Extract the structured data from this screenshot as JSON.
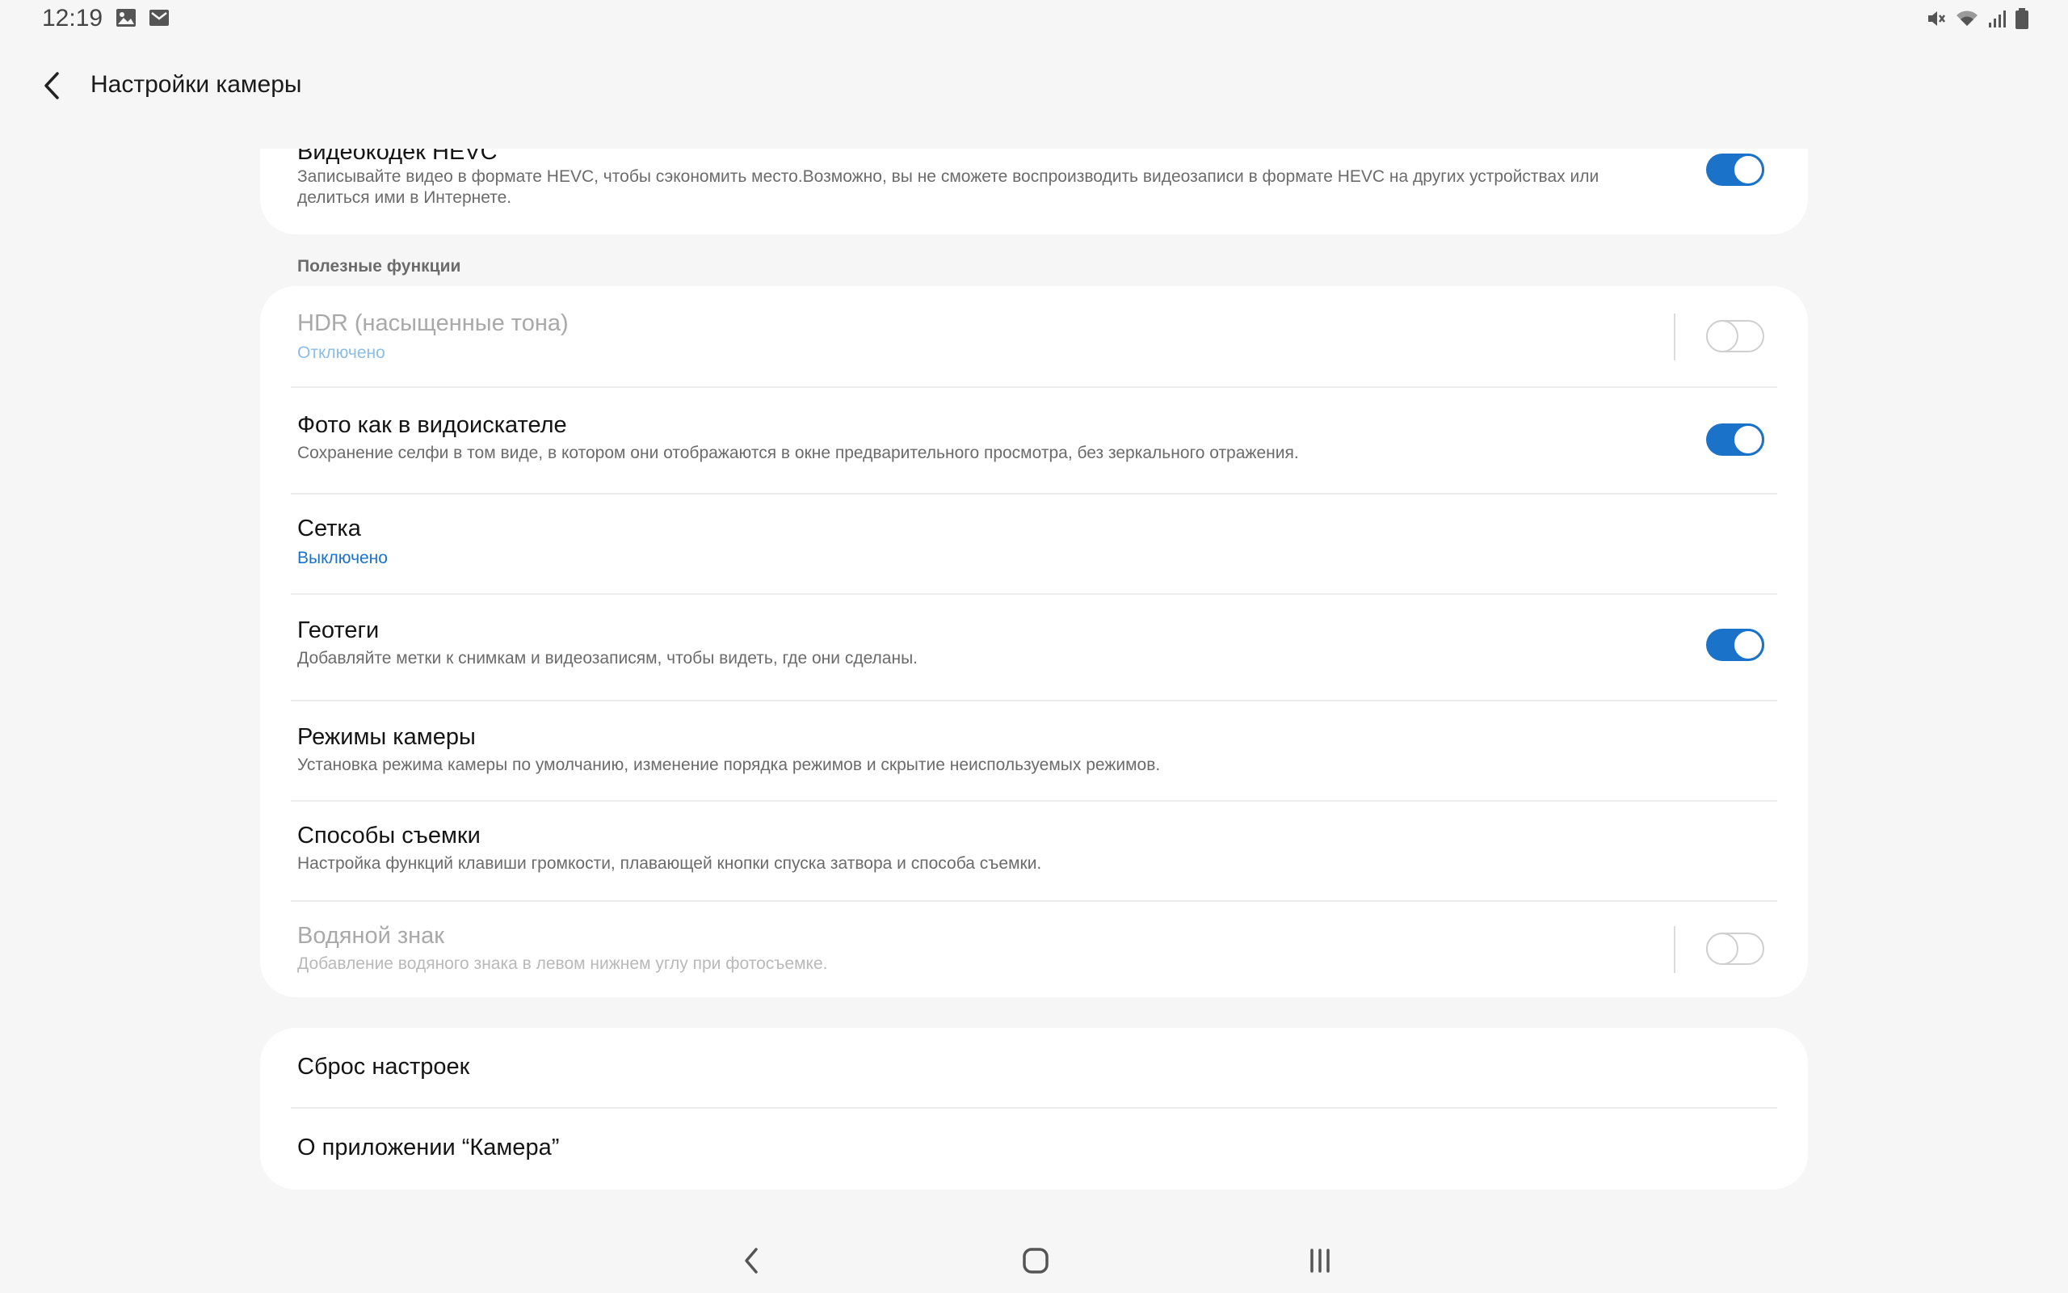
{
  "status_bar": {
    "time": "12:19",
    "left_icons": [
      "gallery-icon",
      "mail-icon"
    ],
    "right_icons": [
      "mute-icon",
      "wifi-icon",
      "signal-icon",
      "battery-icon"
    ]
  },
  "header": {
    "back_icon": "chevron-left-icon",
    "title": "Настройки камеры"
  },
  "hevc": {
    "title": "Видеокодек HEVC",
    "description": "Записывайте видео в формате HEVC, чтобы сэкономить место.Возможно, вы не сможете воспроизводить видеозаписи в формате HEVC на других устройствах или делиться ими в Интернете.",
    "toggle": true
  },
  "useful_section": {
    "header": "Полезные функции",
    "items": [
      {
        "title": "HDR (насыщенные тона)",
        "subtitle": "Отключено",
        "toggle": false,
        "enabled": false
      },
      {
        "title": "Фото как в видоискателе",
        "subtitle": "Сохранение селфи в том виде, в котором они отображаются в окне предварительного просмотра, без зеркального отражения.",
        "toggle": true,
        "enabled": true
      },
      {
        "title": "Сетка",
        "subtitle": "Выключено",
        "enabled": true
      },
      {
        "title": "Геотеги",
        "subtitle": "Добавляйте метки к снимкам и видеозаписям, чтобы видеть, где они сделаны.",
        "toggle": true,
        "enabled": true
      },
      {
        "title": "Режимы камеры",
        "subtitle": "Установка режима камеры по умолчанию, изменение порядка режимов и скрытие неиспользуемых режимов.",
        "enabled": true
      },
      {
        "title": "Способы съемки",
        "subtitle": "Настройка функций клавиши громкости, плавающей кнопки спуска затвора и способа съемки.",
        "enabled": true
      },
      {
        "title": "Водяной знак",
        "subtitle": "Добавление водяного знака в левом нижнем углу при фотосъемке.",
        "toggle": false,
        "enabled": false
      }
    ]
  },
  "bottom_section": {
    "items": [
      {
        "title": "Сброс настроек"
      },
      {
        "title": "О приложении “Камера”"
      }
    ]
  },
  "nav_bar": {
    "icons": [
      "nav-back-icon",
      "nav-home-icon",
      "nav-recents-icon"
    ]
  },
  "colors": {
    "accent": "#1a73c9",
    "background": "#f6f6f6",
    "card": "#ffffff"
  }
}
